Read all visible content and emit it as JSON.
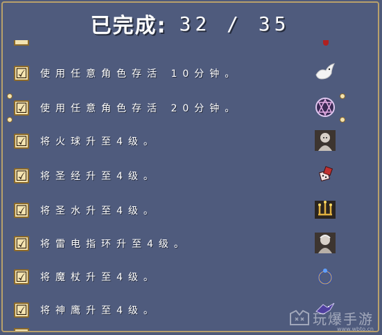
{
  "header": {
    "label": "已完成:",
    "count": "32 / 35"
  },
  "achievements": [
    {
      "text": "使用任意角色存活 10分钟。",
      "checked": true,
      "reward_icon": "dove-icon"
    },
    {
      "text": "使用任意角色存活 20分钟。",
      "checked": true,
      "reward_icon": "magic-circle-icon"
    },
    {
      "text": "将火球升至4级。",
      "checked": true,
      "reward_icon": "character-portrait-icon"
    },
    {
      "text": "将圣经升至4级。",
      "checked": true,
      "reward_icon": "dice-icon"
    },
    {
      "text": "将圣水升至4级。",
      "checked": true,
      "reward_icon": "candelabra-icon"
    },
    {
      "text": "将雷电指环升至4级。",
      "checked": true,
      "reward_icon": "character-portrait-icon"
    },
    {
      "text": "将魔杖升至4级。",
      "checked": true,
      "reward_icon": "ring-icon"
    },
    {
      "text": "将神鹰升至4级。",
      "checked": true,
      "reward_icon": "bird-icon"
    }
  ],
  "checkbox_glyph": "☑",
  "watermark": {
    "text": "玩爆手游",
    "url": "www.wbto.cn"
  }
}
